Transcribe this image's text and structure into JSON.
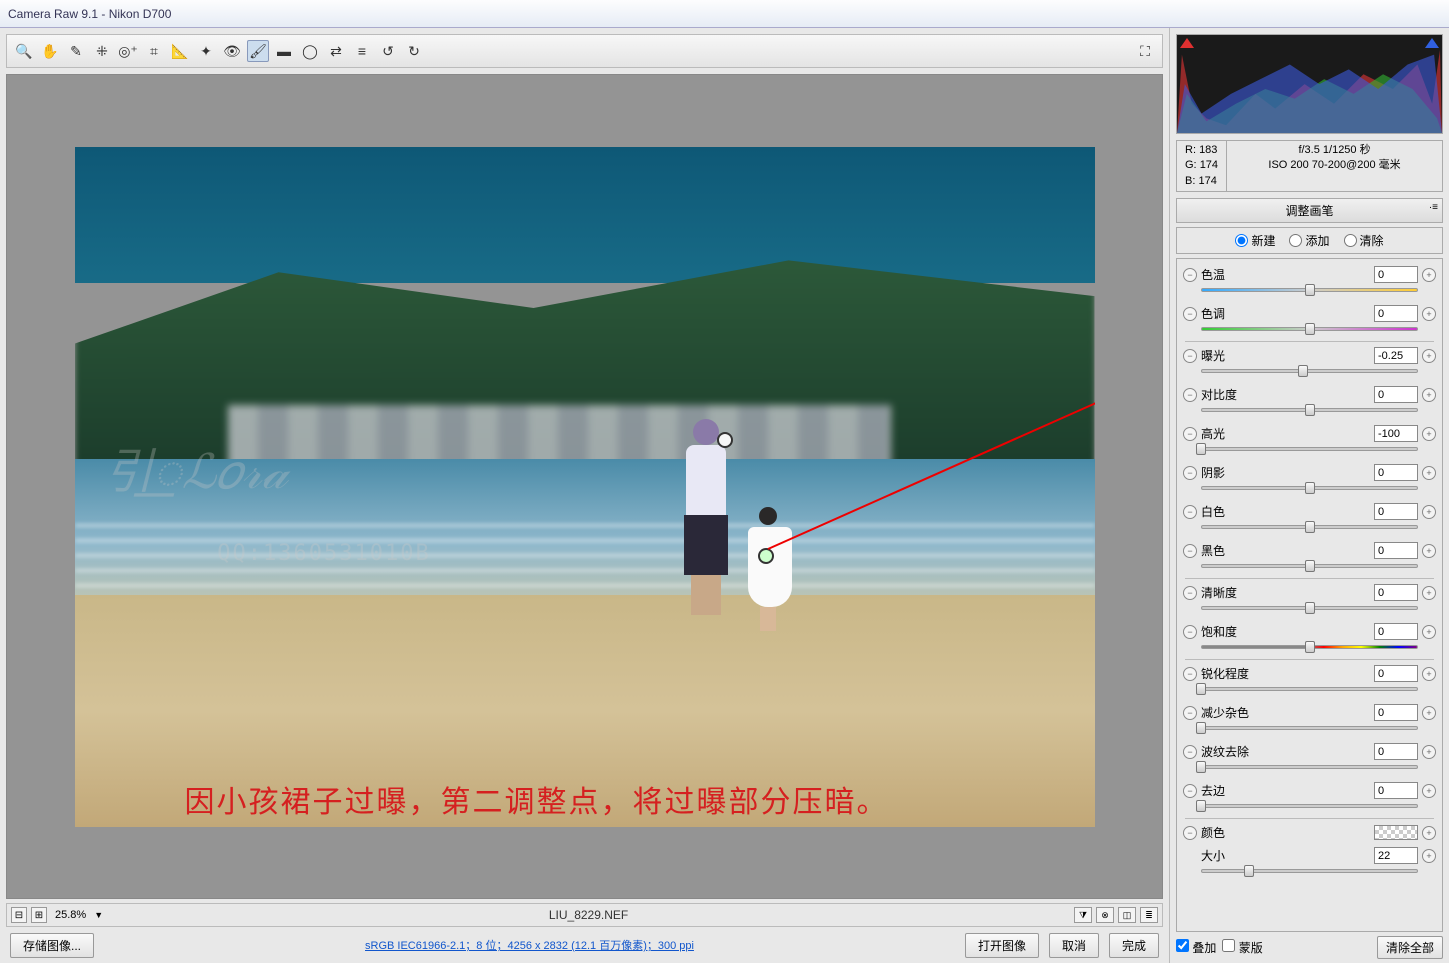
{
  "window": {
    "title": "Camera Raw 9.1  -  Nikon D700"
  },
  "toolbar_icons": [
    "zoom",
    "hand",
    "eyedropper",
    "sampler",
    "target",
    "crop",
    "straighten",
    "spot",
    "eye",
    "brush",
    "grad",
    "radial",
    "swap",
    "bw",
    "rotate-l",
    "settings",
    "rotate-ccw",
    "rotate-cw"
  ],
  "fullscreen_icon": "fullscreen",
  "zoom": {
    "minus": "⊟",
    "plus": "⊞",
    "level": "25.8%"
  },
  "filename": "LIU_8229.NEF",
  "view_icons": [
    "filter",
    "star",
    "compare",
    "strip"
  ],
  "footer": {
    "save": "存储图像...",
    "profile_link": "sRGB IEC61966-2.1；8 位；4256 x 2832 (12.1 百万像素)；300 ppi",
    "open": "打开图像",
    "cancel": "取消",
    "done": "完成"
  },
  "readout": {
    "r_label": "R:",
    "r": "183",
    "g_label": "G:",
    "g": "174",
    "b_label": "B:",
    "b": "174",
    "exif1": "f/3.5  1/1250 秒",
    "exif2": "ISO 200  70-200@200 毫米"
  },
  "panel": {
    "title": "调整画笔",
    "radios": {
      "new": "新建",
      "add": "添加",
      "clear": "清除"
    }
  },
  "sliders": [
    {
      "key": "temp",
      "label": "色温",
      "value": "0",
      "pos": 50,
      "grad": "gradient-temp"
    },
    {
      "key": "tint",
      "label": "色调",
      "value": "0",
      "pos": 50,
      "grad": "gradient-tint"
    },
    {
      "sep": true
    },
    {
      "key": "exposure",
      "label": "曝光",
      "value": "-0.25",
      "pos": 47
    },
    {
      "key": "contrast",
      "label": "对比度",
      "value": "0",
      "pos": 50
    },
    {
      "key": "highlights",
      "label": "高光",
      "value": "-100",
      "pos": 0
    },
    {
      "key": "shadows",
      "label": "阴影",
      "value": "0",
      "pos": 50
    },
    {
      "key": "whites",
      "label": "白色",
      "value": "0",
      "pos": 50
    },
    {
      "key": "blacks",
      "label": "黑色",
      "value": "0",
      "pos": 50
    },
    {
      "sep": true
    },
    {
      "key": "clarity",
      "label": "清晰度",
      "value": "0",
      "pos": 50
    },
    {
      "key": "saturation",
      "label": "饱和度",
      "value": "0",
      "pos": 50,
      "grad": "gradient-sat"
    },
    {
      "sep": true
    },
    {
      "key": "sharpness",
      "label": "锐化程度",
      "value": "0",
      "pos": 0
    },
    {
      "key": "noise",
      "label": "减少杂色",
      "value": "0",
      "pos": 0
    },
    {
      "key": "moire",
      "label": "波纹去除",
      "value": "0",
      "pos": 0
    },
    {
      "key": "defringe",
      "label": "去边",
      "value": "0",
      "pos": 0
    },
    {
      "sep": true
    },
    {
      "key": "color",
      "label": "颜色",
      "swatch": true
    },
    {
      "key": "size",
      "label": "大小",
      "value": "22",
      "pos": 22,
      "nolead": true
    }
  ],
  "bottom": {
    "overlay": "叠加",
    "mask": "蒙版",
    "clear_all": "清除全部"
  },
  "annotation": "因小孩裙子过曝，第二调整点，将过曝部分压暗。",
  "watermark_text": "QQ:1360531010B"
}
